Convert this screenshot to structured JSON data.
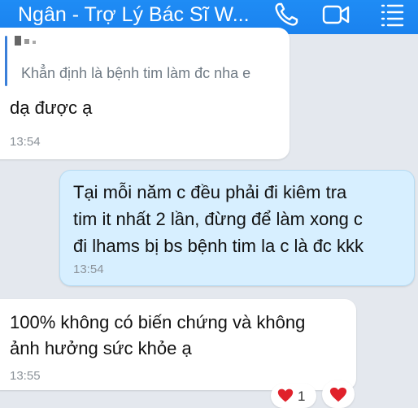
{
  "header": {
    "title": "Ngân - Trợ Lý Bác Sĩ W...",
    "icons": [
      "phone-icon",
      "video-call-icon",
      "menu-icon"
    ],
    "color": "#1f8cf5"
  },
  "messages": [
    {
      "side": "left",
      "quote": {
        "text": "Khẳn định là bệnh tim làm đc nha e"
      },
      "lines": [
        "dạ được ạ"
      ],
      "time": "13:54"
    },
    {
      "side": "right",
      "lines": [
        "Tại mỗi năm c đều phải đi kiêm tra",
        "tim it nhất 2 lần, đừng để làm xong c",
        "đi lhams bị bs bệnh tim la c là đc kkk"
      ],
      "time": "13:54"
    },
    {
      "side": "left",
      "lines": [
        "100% không có biến chứng và không",
        "ảnh hưởng sức khỏe ạ"
      ],
      "time": "13:55",
      "reaction": {
        "icon": "heart-icon",
        "count": "1"
      }
    }
  ],
  "react_button": {
    "icon": "heart-icon"
  },
  "colors": {
    "background": "#e4e8ee",
    "outgoing_bubble": "#d7efff",
    "heart": "#e0212b"
  }
}
